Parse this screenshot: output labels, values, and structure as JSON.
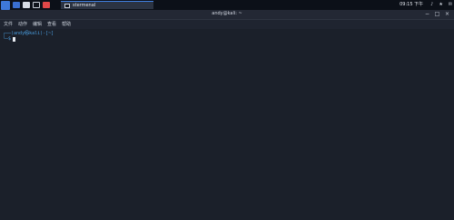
{
  "panel": {
    "task_label": "stermenal",
    "tray": [
      "♪",
      "★",
      "✉"
    ],
    "clock": "09:15 下午",
    "launcher_color": "#3e78d8",
    "panel_icon_colors": [
      "#3a6fd0",
      "#d8dce4",
      "#11151d",
      "#e04848"
    ]
  },
  "window": {
    "title": "andy@kali: ~",
    "controls": [
      "−",
      "□",
      "×"
    ]
  },
  "menu": [
    "文件",
    "动作",
    "编辑",
    "查看",
    "帮助"
  ],
  "terminal": {
    "prompt_top": "┌──(andy㉿kali)-[~]",
    "prompt_bottom": "└─$"
  }
}
